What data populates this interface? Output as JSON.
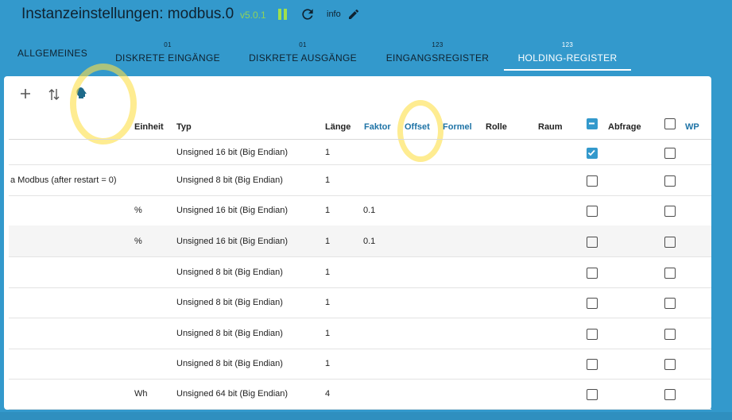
{
  "header": {
    "title": "Instanzeinstellungen: modbus.0",
    "version": "v5.0.1",
    "info_label": "info"
  },
  "tabs": [
    {
      "label": "ALLGEMEINES",
      "badge": ""
    },
    {
      "label": "DISKRETE EINGÄNGE",
      "badge": "01"
    },
    {
      "label": "DISKRETE AUSGÄNGE",
      "badge": "01"
    },
    {
      "label": "EINGANGSREGISTER",
      "badge": "123"
    },
    {
      "label": "HOLDING-REGISTER",
      "badge": "123",
      "active": true
    }
  ],
  "columns": {
    "einheit": "Einheit",
    "typ": "Typ",
    "laenge": "Länge",
    "faktor": "Faktor",
    "offset": "Offset",
    "formel": "Formel",
    "rolle": "Rolle",
    "raum": "Raum",
    "abfrage": "Abfrage",
    "wp": "WP"
  },
  "rows": [
    {
      "name": "",
      "unit": "",
      "type": "Unsigned 16 bit (Big Endian)",
      "len": "1",
      "factor": "",
      "poll": true,
      "wp": false
    },
    {
      "name": "a Modbus (after restart = 0)",
      "unit": "",
      "type": "Unsigned 8 bit (Big Endian)",
      "len": "1",
      "factor": "",
      "poll": false,
      "wp": false
    },
    {
      "name": "",
      "unit": "%",
      "type": "Unsigned 16 bit (Big Endian)",
      "len": "1",
      "factor": "0.1",
      "poll": false,
      "wp": false
    },
    {
      "name": "",
      "unit": "%",
      "type": "Unsigned 16 bit (Big Endian)",
      "len": "1",
      "factor": "0.1",
      "poll": false,
      "wp": false
    },
    {
      "name": "",
      "unit": "",
      "type": "Unsigned 8 bit (Big Endian)",
      "len": "1",
      "factor": "",
      "poll": false,
      "wp": false
    },
    {
      "name": "",
      "unit": "",
      "type": "Unsigned 8 bit (Big Endian)",
      "len": "1",
      "factor": "",
      "poll": false,
      "wp": false
    },
    {
      "name": "",
      "unit": "",
      "type": "Unsigned 8 bit (Big Endian)",
      "len": "1",
      "factor": "",
      "poll": false,
      "wp": false
    },
    {
      "name": "",
      "unit": "",
      "type": "Unsigned 8 bit (Big Endian)",
      "len": "1",
      "factor": "",
      "poll": false,
      "wp": false
    },
    {
      "name": "",
      "unit": "Wh",
      "type": "Unsigned 64 bit (Big Endian)",
      "len": "4",
      "factor": "",
      "poll": false,
      "wp": false
    }
  ],
  "colors": {
    "accent": "#3399cc",
    "highlight": "#fde047"
  }
}
